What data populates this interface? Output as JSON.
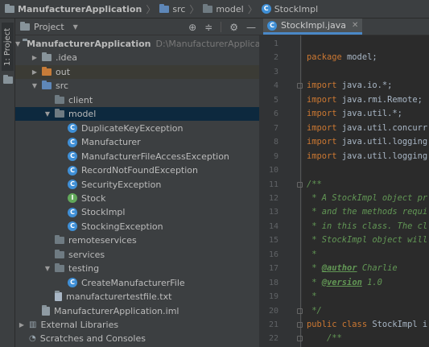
{
  "breadcrumbs": [
    "ManufacturerApplication",
    "src",
    "model",
    "StockImpl"
  ],
  "side_tab": "1: Project",
  "project_panel": {
    "title": "Project",
    "header_icons": [
      "target-icon",
      "collapse-icon",
      "gear-icon",
      "minimize-icon"
    ]
  },
  "tree": [
    {
      "label": "ManufacturerApplication",
      "path": "D:\\ManufacturerApplication",
      "depth": 0,
      "arrow": "down",
      "icon": "project-folder",
      "bold": true
    },
    {
      "label": ".idea",
      "depth": 1,
      "arrow": "right",
      "icon": "folder"
    },
    {
      "label": "out",
      "depth": 1,
      "arrow": "right",
      "icon": "folder-orange",
      "highlight": true
    },
    {
      "label": "src",
      "depth": 1,
      "arrow": "down",
      "icon": "folder-blue"
    },
    {
      "label": "client",
      "depth": 2,
      "arrow": "",
      "icon": "folder-dark"
    },
    {
      "label": "model",
      "depth": 2,
      "arrow": "down",
      "icon": "folder-dark",
      "selected": true
    },
    {
      "label": "DuplicateKeyException",
      "depth": 3,
      "arrow": "",
      "icon": "class"
    },
    {
      "label": "Manufacturer",
      "depth": 3,
      "arrow": "",
      "icon": "class"
    },
    {
      "label": "ManufacturerFileAccessException",
      "depth": 3,
      "arrow": "",
      "icon": "class"
    },
    {
      "label": "RecordNotFoundException",
      "depth": 3,
      "arrow": "",
      "icon": "class"
    },
    {
      "label": "SecurityException",
      "depth": 3,
      "arrow": "",
      "icon": "class"
    },
    {
      "label": "Stock",
      "depth": 3,
      "arrow": "",
      "icon": "interface"
    },
    {
      "label": "StockImpl",
      "depth": 3,
      "arrow": "",
      "icon": "class"
    },
    {
      "label": "StockingException",
      "depth": 3,
      "arrow": "",
      "icon": "class"
    },
    {
      "label": "remoteservices",
      "depth": 2,
      "arrow": "",
      "icon": "folder-dark"
    },
    {
      "label": "services",
      "depth": 2,
      "arrow": "",
      "icon": "folder-dark"
    },
    {
      "label": "testing",
      "depth": 2,
      "arrow": "down",
      "icon": "folder-dark"
    },
    {
      "label": "CreateManufacturerFile",
      "depth": 3,
      "arrow": "",
      "icon": "class"
    },
    {
      "label": "manufacturertestfile.txt",
      "depth": 2,
      "arrow": "",
      "icon": "text-file"
    },
    {
      "label": "ManufacturerApplication.iml",
      "depth": 1,
      "arrow": "",
      "icon": "module-file"
    },
    {
      "label": "External Libraries",
      "depth": 0,
      "arrow": "right",
      "icon": "libraries"
    },
    {
      "label": "Scratches and Consoles",
      "depth": 0,
      "arrow": "",
      "icon": "scratches"
    }
  ],
  "editor_tab": "StockImpl.java",
  "line_numbers": [
    "1",
    "2",
    "3",
    "4",
    "5",
    "6",
    "7",
    "8",
    "9",
    "10",
    "11",
    "12",
    "13",
    "14",
    "15",
    "16",
    "17",
    "18",
    "19",
    "20",
    "21",
    "22"
  ],
  "code_lines": [
    [],
    [
      {
        "t": "package ",
        "c": "kw"
      },
      {
        "t": "model;",
        "c": ""
      }
    ],
    [],
    [
      {
        "t": "import ",
        "c": "kw"
      },
      {
        "t": "java.io.*;",
        "c": ""
      }
    ],
    [
      {
        "t": "import ",
        "c": "kw"
      },
      {
        "t": "java.rmi.Remote;",
        "c": ""
      }
    ],
    [
      {
        "t": "import ",
        "c": "kw"
      },
      {
        "t": "java.util.*;",
        "c": ""
      }
    ],
    [
      {
        "t": "import ",
        "c": "kw"
      },
      {
        "t": "java.util.concurr",
        "c": ""
      }
    ],
    [
      {
        "t": "import ",
        "c": "kw"
      },
      {
        "t": "java.util.logging",
        "c": ""
      }
    ],
    [
      {
        "t": "import ",
        "c": "kw"
      },
      {
        "t": "java.util.logging",
        "c": ""
      }
    ],
    [],
    [
      {
        "t": "/**",
        "c": "cm"
      }
    ],
    [
      {
        "t": " * A StockImpl object pr",
        "c": "cm"
      }
    ],
    [
      {
        "t": " * and the methods requi",
        "c": "cm"
      }
    ],
    [
      {
        "t": " * in this class. The cl",
        "c": "cm"
      }
    ],
    [
      {
        "t": " * StockImpl object will",
        "c": "cm"
      }
    ],
    [
      {
        "t": " *",
        "c": "cm"
      }
    ],
    [
      {
        "t": " * ",
        "c": "cm"
      },
      {
        "t": "@author",
        "c": "tag"
      },
      {
        "t": " Charlie",
        "c": "cm"
      }
    ],
    [
      {
        "t": " * ",
        "c": "cm"
      },
      {
        "t": "@version",
        "c": "tag"
      },
      {
        "t": " 1.0",
        "c": "cm"
      }
    ],
    [
      {
        "t": " *",
        "c": "cm"
      }
    ],
    [
      {
        "t": " */",
        "c": "cm"
      }
    ],
    [
      {
        "t": "public class ",
        "c": "kw"
      },
      {
        "t": "StockImpl i",
        "c": ""
      }
    ],
    [
      {
        "t": "    /**",
        "c": "cm"
      }
    ]
  ]
}
